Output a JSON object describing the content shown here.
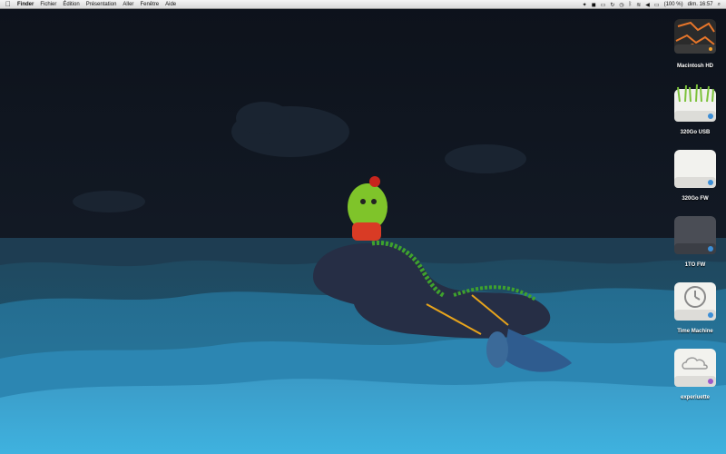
{
  "menubar": {
    "app_name": "Finder",
    "items": [
      "Fichier",
      "Édition",
      "Présentation",
      "Aller",
      "Fenêtre",
      "Aide"
    ],
    "battery": "(100 %)",
    "clock": "dim. 16:57"
  },
  "desktop": {
    "drives": [
      {
        "label": "Macintosh HD",
        "icon": "lava-hard-drive-icon"
      },
      {
        "label": "320Go USB",
        "icon": "grass-drive-icon"
      },
      {
        "label": "320Go FW",
        "icon": "white-drive-icon"
      },
      {
        "label": "1TO FW",
        "icon": "dark-drive-icon"
      },
      {
        "label": "Time Machine",
        "icon": "time-machine-drive-icon"
      },
      {
        "label": "experiuette",
        "icon": "cloud-drive-icon"
      }
    ]
  }
}
